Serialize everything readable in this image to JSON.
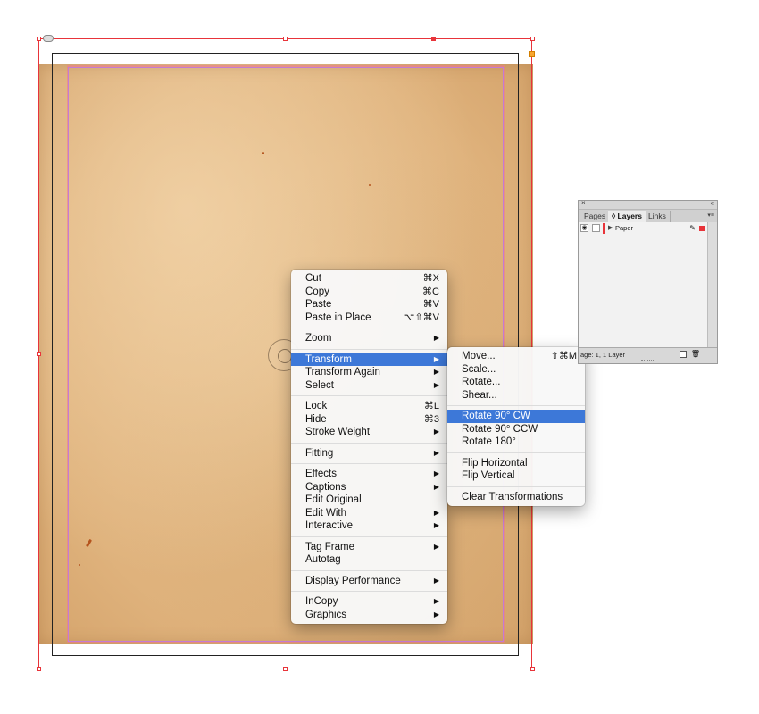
{
  "context_menu": {
    "groups": [
      [
        {
          "label": "Cut",
          "shortcut": "⌘X",
          "submenu": false
        },
        {
          "label": "Copy",
          "shortcut": "⌘C",
          "submenu": false
        },
        {
          "label": "Paste",
          "shortcut": "⌘V",
          "submenu": false
        },
        {
          "label": "Paste in Place",
          "shortcut": "⌥⇧⌘V",
          "submenu": false
        }
      ],
      [
        {
          "label": "Zoom",
          "shortcut": "",
          "submenu": true
        }
      ],
      [
        {
          "label": "Transform",
          "shortcut": "",
          "submenu": true,
          "active": true
        },
        {
          "label": "Transform Again",
          "shortcut": "",
          "submenu": true
        },
        {
          "label": "Select",
          "shortcut": "",
          "submenu": true
        }
      ],
      [
        {
          "label": "Lock",
          "shortcut": "⌘L",
          "submenu": false
        },
        {
          "label": "Hide",
          "shortcut": "⌘3",
          "submenu": false
        },
        {
          "label": "Stroke Weight",
          "shortcut": "",
          "submenu": true
        }
      ],
      [
        {
          "label": "Fitting",
          "shortcut": "",
          "submenu": true
        }
      ],
      [
        {
          "label": "Effects",
          "shortcut": "",
          "submenu": true
        },
        {
          "label": "Captions",
          "shortcut": "",
          "submenu": true
        },
        {
          "label": "Edit Original",
          "shortcut": "",
          "submenu": false
        },
        {
          "label": "Edit With",
          "shortcut": "",
          "submenu": true
        },
        {
          "label": "Interactive",
          "shortcut": "",
          "submenu": true
        }
      ],
      [
        {
          "label": "Tag Frame",
          "shortcut": "",
          "submenu": true
        },
        {
          "label": "Autotag",
          "shortcut": "",
          "submenu": false
        }
      ],
      [
        {
          "label": "Display Performance",
          "shortcut": "",
          "submenu": true
        }
      ],
      [
        {
          "label": "InCopy",
          "shortcut": "",
          "submenu": true
        },
        {
          "label": "Graphics",
          "shortcut": "",
          "submenu": true
        }
      ]
    ]
  },
  "transform_submenu": {
    "groups": [
      [
        {
          "label": "Move...",
          "shortcut": "⇧⌘M"
        },
        {
          "label": "Scale...",
          "shortcut": ""
        },
        {
          "label": "Rotate...",
          "shortcut": ""
        },
        {
          "label": "Shear...",
          "shortcut": ""
        }
      ],
      [
        {
          "label": "Rotate 90° CW",
          "shortcut": "",
          "active": true
        },
        {
          "label": "Rotate 90° CCW",
          "shortcut": ""
        },
        {
          "label": "Rotate 180°",
          "shortcut": ""
        }
      ],
      [
        {
          "label": "Flip Horizontal",
          "shortcut": ""
        },
        {
          "label": "Flip Vertical",
          "shortcut": ""
        }
      ],
      [
        {
          "label": "Clear Transformations",
          "shortcut": ""
        }
      ]
    ]
  },
  "layers_panel": {
    "close_glyph": "×",
    "collapse_glyph": "«",
    "tabs": [
      {
        "label": "Pages",
        "active": false
      },
      {
        "label": "◊ Layers",
        "active": true
      },
      {
        "label": "Links",
        "active": false
      }
    ],
    "menu_glyph": "▾≡",
    "layers": [
      {
        "name": "Paper",
        "color": "#e8343a"
      }
    ],
    "footer_info": "age: 1, 1 Layer"
  },
  "icons": {
    "submenu_arrow": "▶",
    "eye": "◉",
    "pen": "✎",
    "trash": "🗑"
  },
  "colors": {
    "selection_frame": "#e8343a",
    "menu_highlight": "#3d78d8",
    "margin_guide": "#c47bd4"
  }
}
